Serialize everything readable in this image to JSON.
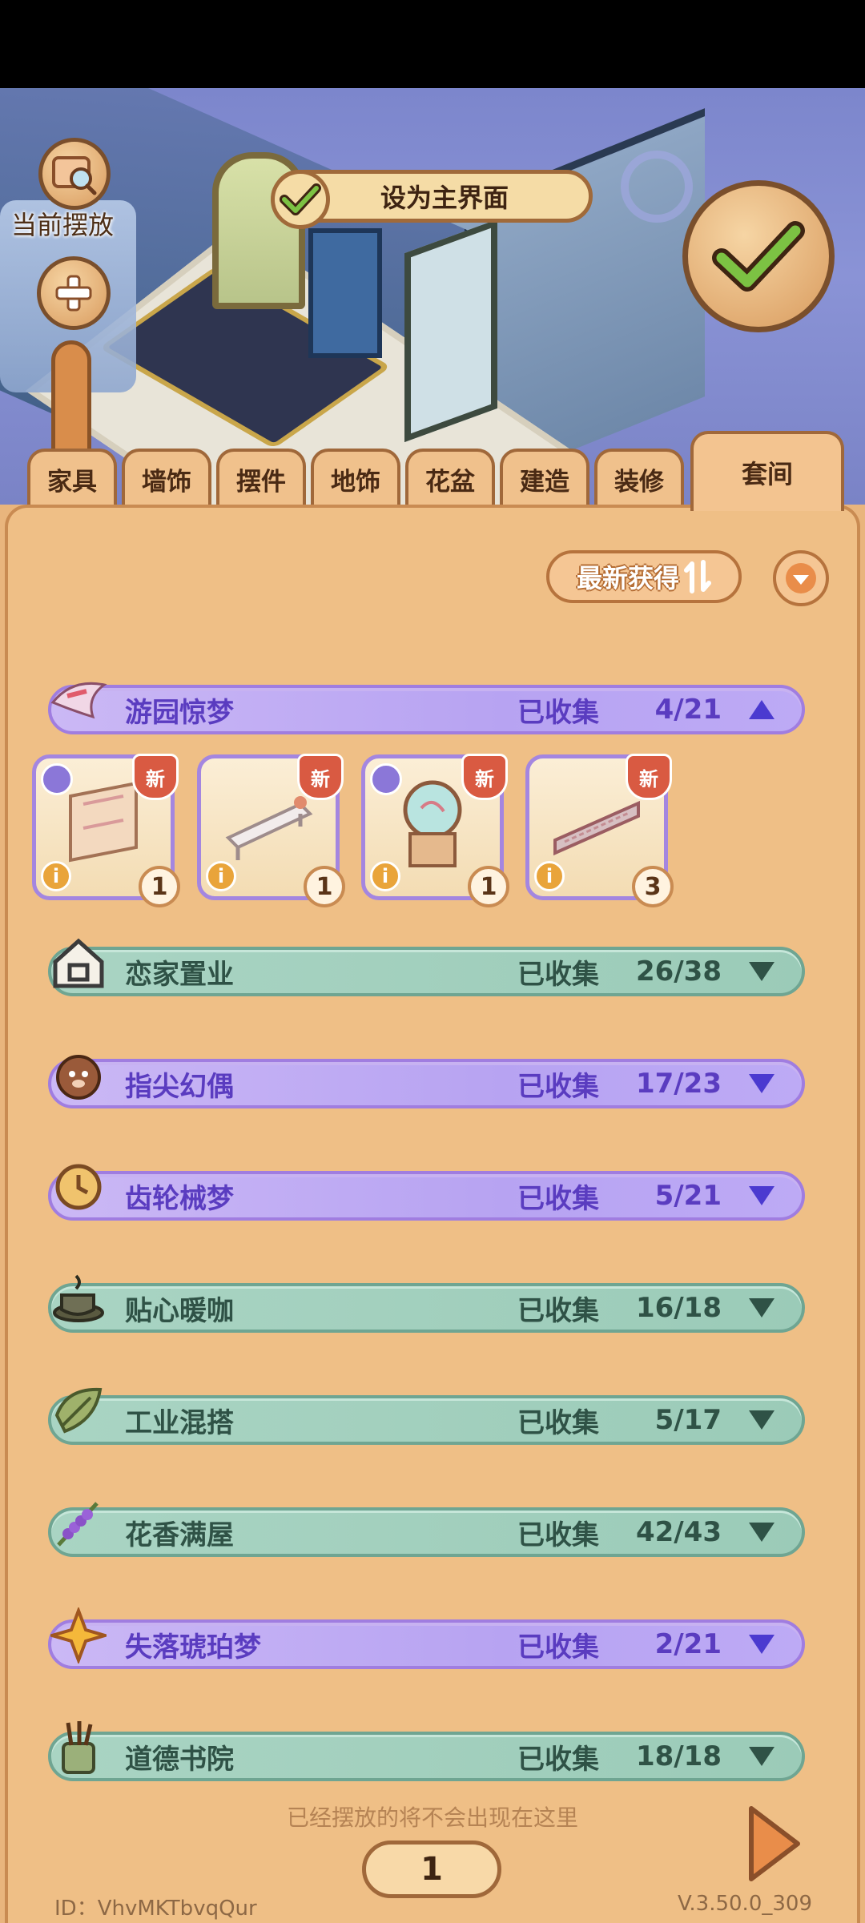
{
  "header": {
    "current_placement_label": "当前摆放",
    "set_home_label": "设为主界面"
  },
  "tabs": [
    {
      "label": "家具"
    },
    {
      "label": "墙饰"
    },
    {
      "label": "摆件"
    },
    {
      "label": "地饰"
    },
    {
      "label": "花盆"
    },
    {
      "label": "建造"
    },
    {
      "label": "装修"
    },
    {
      "label": "套间",
      "active": true
    }
  ],
  "toolbar": {
    "sort_label": "最新获得"
  },
  "sets": [
    {
      "name": "游园惊梦",
      "collected_label": "已收集",
      "count": "4/21",
      "expanded": true,
      "style": "purple",
      "icon": "bird-icon"
    },
    {
      "name": "恋家置业",
      "collected_label": "已收集",
      "count": "26/38",
      "expanded": false,
      "style": "green",
      "icon": "house-icon"
    },
    {
      "name": "指尖幻偶",
      "collected_label": "已收集",
      "count": "17/23",
      "expanded": false,
      "style": "purple",
      "icon": "puppy-icon"
    },
    {
      "name": "齿轮械梦",
      "collected_label": "已收集",
      "count": "5/21",
      "expanded": false,
      "style": "purple",
      "icon": "clock-icon"
    },
    {
      "name": "贴心暖咖",
      "collected_label": "已收集",
      "count": "16/18",
      "expanded": false,
      "style": "green",
      "icon": "coffee-icon"
    },
    {
      "name": "工业混搭",
      "collected_label": "已收集",
      "count": "5/17",
      "expanded": false,
      "style": "green",
      "icon": "leaf-icon"
    },
    {
      "name": "花香满屋",
      "collected_label": "已收集",
      "count": "42/43",
      "expanded": false,
      "style": "green",
      "icon": "lavender-icon"
    },
    {
      "name": "失落琥珀梦",
      "collected_label": "已收集",
      "count": "2/21",
      "expanded": false,
      "style": "purple",
      "icon": "star-icon"
    },
    {
      "name": "道德书院",
      "collected_label": "已收集",
      "count": "18/18",
      "expanded": false,
      "style": "green",
      "icon": "brush-icon"
    }
  ],
  "items": [
    {
      "new_label": "新",
      "quantity": "1",
      "info": "i",
      "art": "screen-icon",
      "has_type_icon": true
    },
    {
      "new_label": "新",
      "quantity": "1",
      "info": "i",
      "art": "bench-icon",
      "has_type_icon": false
    },
    {
      "new_label": "新",
      "quantity": "1",
      "info": "i",
      "art": "lantern-icon",
      "has_type_icon": true
    },
    {
      "new_label": "新",
      "quantity": "3",
      "info": "i",
      "art": "railing-icon",
      "has_type_icon": false
    }
  ],
  "footer": {
    "note": "已经摆放的将不会出现在这里",
    "page": "1",
    "user_id": "ID：VhvMKTbvqQur",
    "version": "V.3.50.0_309"
  }
}
